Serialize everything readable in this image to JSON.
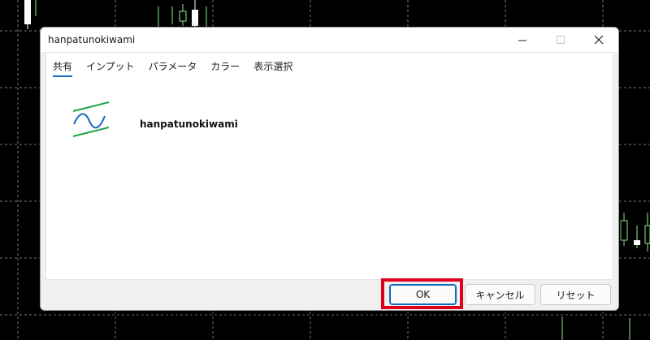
{
  "window": {
    "title": "hanpatunokiwami",
    "minimize_icon": "minimize-icon",
    "maximize_icon": "maximize-icon",
    "close_icon": "close-icon"
  },
  "tabs": [
    {
      "label": "共有",
      "active": true
    },
    {
      "label": "インプット",
      "active": false
    },
    {
      "label": "パラメータ",
      "active": false
    },
    {
      "label": "カラー",
      "active": false
    },
    {
      "label": "表示選択",
      "active": false
    }
  ],
  "indicator": {
    "name": "hanpatunokiwami",
    "icon": "indicator-wave-icon"
  },
  "buttons": {
    "ok_label": "OK",
    "cancel_label": "キャンセル",
    "reset_label": "リセット"
  },
  "colors": {
    "accent": "#0f6cbd",
    "highlight": "#e0001b",
    "icon_green": "#1aa34a",
    "icon_blue": "#1565c0",
    "chart_candle_up": "#ffffff",
    "chart_candle_bull": "#90ee90"
  }
}
